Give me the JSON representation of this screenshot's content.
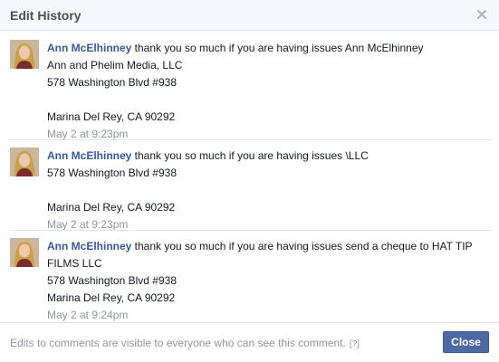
{
  "dialog": {
    "title": "Edit History",
    "close_icon": "close-icon"
  },
  "entries": [
    {
      "author": "Ann McElhinney",
      "text_first": " thank you so much if you are having issues Ann McElhinney",
      "lines": [
        "Ann and Phelim Media, LLC",
        "578 Washington Blvd #938",
        "",
        "Marina Del Rey, CA 90292"
      ],
      "timestamp": "May 2 at 9:23pm"
    },
    {
      "author": "Ann McElhinney",
      "text_first": " thank you so much if you are having issues \\LLC",
      "lines": [
        "578 Washington Blvd #938",
        "",
        "Marina Del Rey, CA 90292"
      ],
      "timestamp": "May 2 at 9:23pm"
    },
    {
      "author": "Ann McElhinney",
      "text_first": " thank you so much if you are having issues send a cheque to HAT TIP",
      "lines": [
        "FILMS LLC",
        "578 Washington Blvd #938",
        "Marina Del Rey, CA 90292"
      ],
      "timestamp": "May 2 at 9:24pm"
    }
  ],
  "footer": {
    "note": "Edits to comments are visible to everyone who can see this comment.",
    "help": "[?]",
    "close_label": "Close"
  },
  "colors": {
    "link": "#3b5998",
    "button": "#4e69a2",
    "muted": "#90949c"
  }
}
